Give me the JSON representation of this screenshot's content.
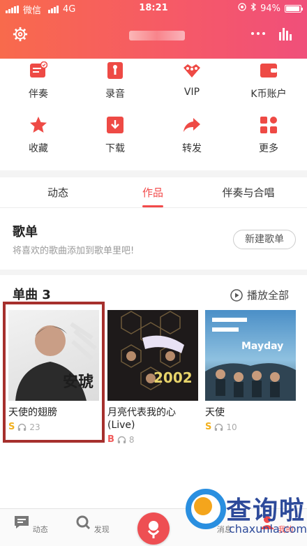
{
  "status_bar": {
    "carrier": "微信",
    "network": "4G",
    "time": "18:21",
    "battery": "94%",
    "battery_level": 0.94
  },
  "grid": [
    {
      "label": "伴奏",
      "icon": "accompaniment-icon"
    },
    {
      "label": "录音",
      "icon": "record-icon"
    },
    {
      "label": "VIP",
      "icon": "vip-icon"
    },
    {
      "label": "K币账户",
      "icon": "wallet-icon"
    },
    {
      "label": "收藏",
      "icon": "star-icon"
    },
    {
      "label": "下载",
      "icon": "download-icon"
    },
    {
      "label": "转发",
      "icon": "share-icon"
    },
    {
      "label": "更多",
      "icon": "more-grid-icon"
    }
  ],
  "tabs": [
    {
      "label": "动态"
    },
    {
      "label": "作品"
    },
    {
      "label": "伴奏与合唱"
    }
  ],
  "playlist": {
    "title": "歌单",
    "subtitle": "将喜欢的歌曲添加到歌单里吧!",
    "new_button": "新建歌单"
  },
  "singles": {
    "title": "单曲 3",
    "play_all": "播放全部",
    "items": [
      {
        "name": "天使的翅膀",
        "badge": "S",
        "badge_color": "#f2b01e",
        "plays": "23",
        "cover_text": "安琥"
      },
      {
        "name": "月亮代表我的心\n(Live)",
        "badge": "B",
        "badge_color": "#f05a5a",
        "plays": "8",
        "cover_text": "2002"
      },
      {
        "name": "天使",
        "badge": "S",
        "badge_color": "#f2b01e",
        "plays": "10",
        "cover_text": "Mayday"
      }
    ]
  },
  "bottom_nav": [
    {
      "label": "动态"
    },
    {
      "label": "发现"
    },
    {
      "label": "消息"
    },
    {
      "label": "我的"
    }
  ],
  "watermark": {
    "text": "查询啦",
    "sub": "chaxunla.com"
  },
  "colors": {
    "accent": "#f24a4a",
    "header_start": "#f86a4c",
    "header_end": "#f04f7a"
  }
}
